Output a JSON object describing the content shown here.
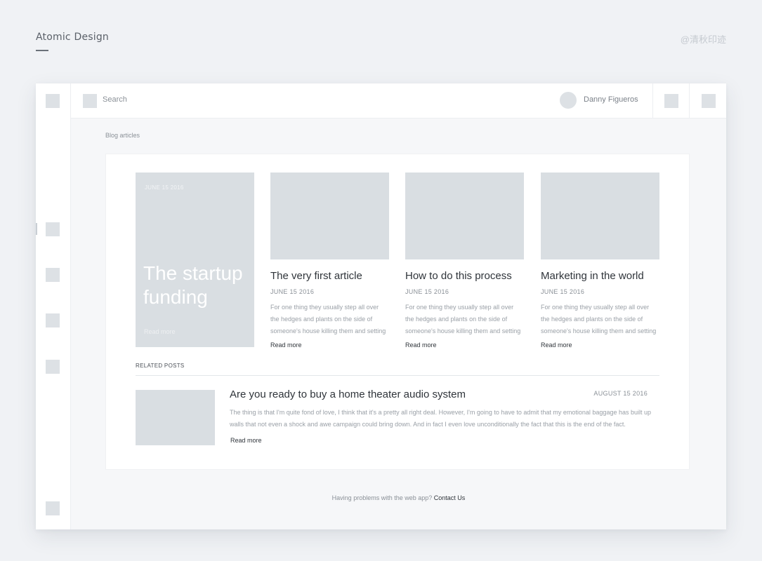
{
  "header": {
    "title": "Atomic Design",
    "watermark": "@清秋印迹"
  },
  "topbar": {
    "search_label": "Search",
    "user_name": "Danny Figueros",
    "user_menu_icon": "chevron-down-icon"
  },
  "breadcrumb": "Blog articles",
  "featured": {
    "date": "JUNE 15 2016",
    "title": "The startup funding",
    "read_more": "Read more"
  },
  "articles": [
    {
      "title": "The very first article",
      "date": "JUNE 15 2016",
      "excerpt": "For one thing they usually step all over the hedges and plants on the side of someone's house killing them and setting",
      "read_more": "Read more"
    },
    {
      "title": "How to do this process",
      "date": "JUNE 15 2016",
      "excerpt": "For one thing they usually step all over the hedges and plants on the side of someone's house killing them and setting",
      "read_more": "Read more"
    },
    {
      "title": "Marketing in the world",
      "date": "JUNE 15 2016",
      "excerpt": "For one thing they usually step all over the hedges and plants on the side of someone's house killing them and setting",
      "read_more": "Read more"
    }
  ],
  "related": {
    "label": "RELATED POSTS",
    "title": "Are you ready to buy a home theater audio system",
    "date": "AUGUST 15 2016",
    "excerpt": "The thing is that I'm quite fond of love, I think that it's a pretty all right deal. However, I'm going to have to admit that my emotional baggage has built up walls that not even a shock and awe campaign could bring down. And in fact I even love unconditionally the fact that this is the end of the fact.",
    "read_more": "Read more"
  },
  "footer": {
    "text": "Having problems with the web app?",
    "link": "Contact Us"
  }
}
